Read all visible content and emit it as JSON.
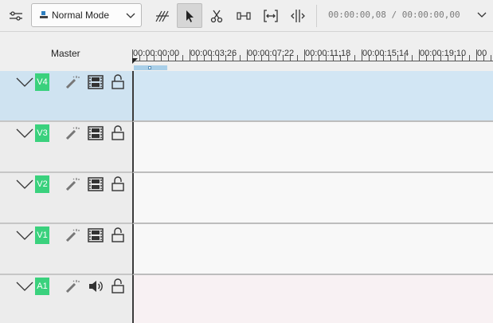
{
  "toolbar": {
    "mode": {
      "selected": "Normal Mode"
    },
    "tools": [
      "timeline-options",
      "mode-select",
      "spacer-tool",
      "selection-tool",
      "razor-tool",
      "slip-tool",
      "multicam-tool",
      "ripple-tool"
    ],
    "timecode": "00:00:00,08 / 00:00:00,00"
  },
  "ruler": {
    "labels": [
      "00:00:00;00",
      "00:00:03;26",
      "00:00:07;22",
      "00:00:11;18",
      "00:00:15;14",
      "00:00:19;10",
      "00"
    ]
  },
  "master": {
    "label": "Master"
  },
  "tracks": [
    {
      "name": "V4",
      "type": "video",
      "selected": true
    },
    {
      "name": "V3",
      "type": "video",
      "selected": false
    },
    {
      "name": "V2",
      "type": "video",
      "selected": false
    },
    {
      "name": "V1",
      "type": "video",
      "selected": false
    },
    {
      "name": "A1",
      "type": "audio",
      "selected": false
    }
  ],
  "colors": {
    "accent": "#3ad17d",
    "selected_track": "#d2e6f4",
    "audio_track": "#f8f1f3"
  }
}
